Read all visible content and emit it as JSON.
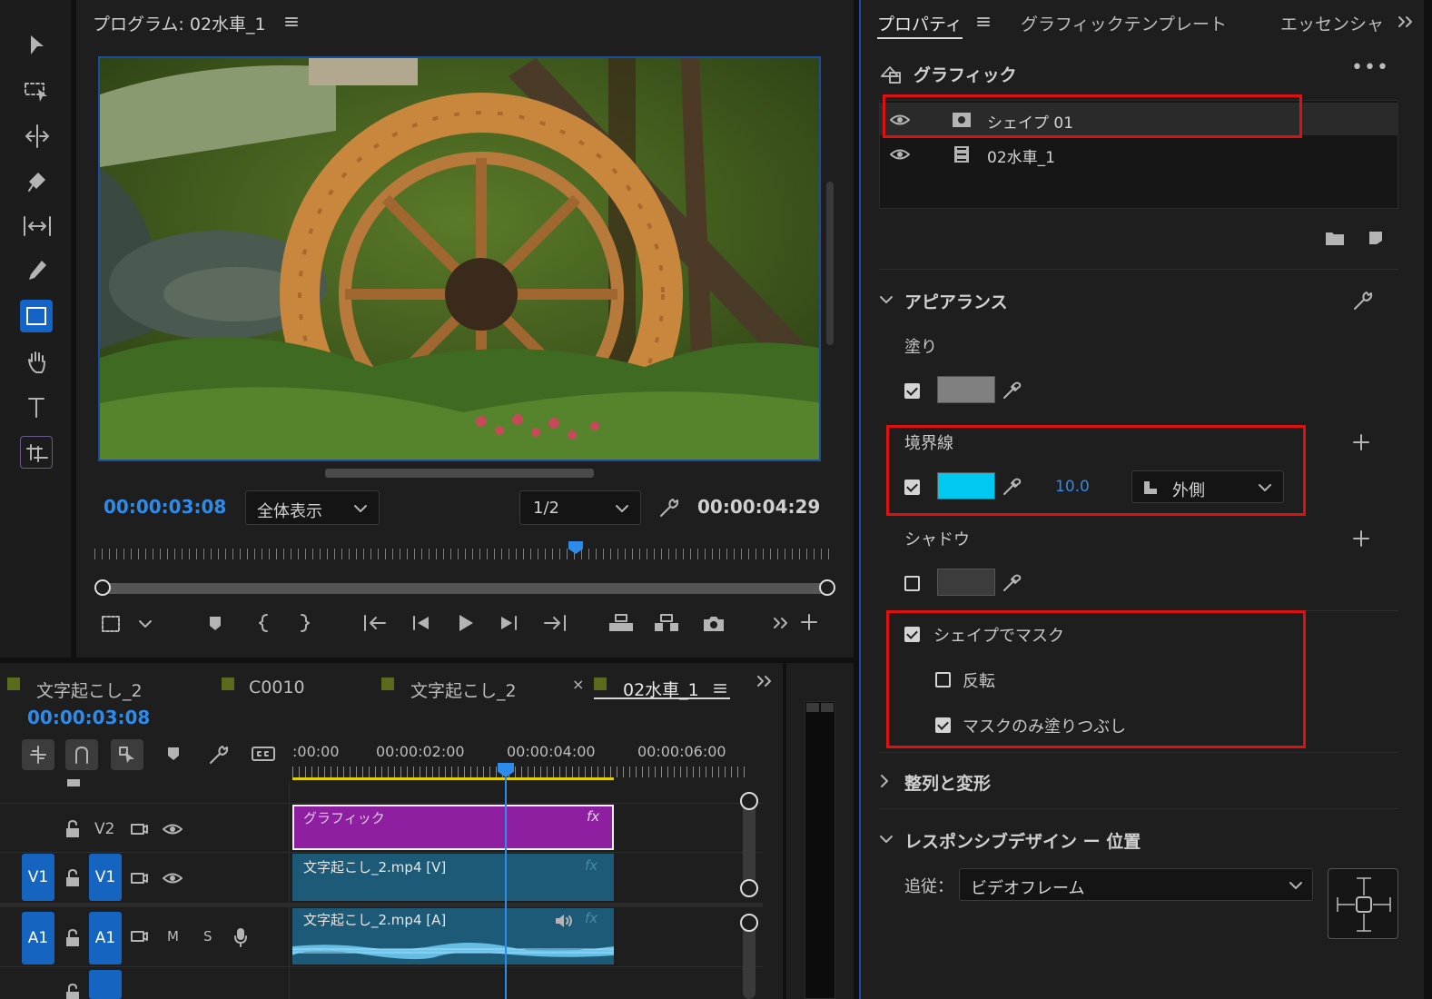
{
  "program_monitor": {
    "title": "プログラム: 02水車_1",
    "timecode_current": "00:00:03:08",
    "zoom_select": "全体表示",
    "resolution_select": "1/2",
    "timecode_duration": "00:00:04:29"
  },
  "properties_panel": {
    "tabs": [
      "プロパティ",
      "グラフィックテンプレート",
      "エッセンシャ"
    ],
    "graphic_header": "グラフィック",
    "layers": [
      {
        "name": "シェイプ 01",
        "type": "shape"
      },
      {
        "name": "02水車_1",
        "type": "video"
      }
    ],
    "appearance": {
      "section_title": "アピアランス",
      "fill_label": "塗り",
      "fill_checked": true,
      "fill_color": "#808080",
      "stroke_label": "境界線",
      "stroke_checked": true,
      "stroke_color": "#00c8f0",
      "stroke_width": "10.0",
      "stroke_position": "外側",
      "shadow_label": "シャドウ",
      "shadow_checked": false,
      "shadow_color": "#3c3c3c"
    },
    "mask": {
      "mask_with_shape_label": "シェイプでマスク",
      "mask_with_shape_checked": true,
      "invert_label": "反転",
      "invert_checked": false,
      "fill_mask_only_label": "マスクのみ塗りつぶし",
      "fill_mask_only_checked": true
    },
    "align_transform_title": "整列と変形",
    "responsive_title": "レスポンシブデザイン ー 位置",
    "follow_label": "追従：",
    "follow_value": "ビデオフレーム"
  },
  "timeline": {
    "tabs": [
      {
        "label": "文字起こし_2",
        "color": "#5a6b1c"
      },
      {
        "label": "C0010",
        "color": "#5a6b1c"
      },
      {
        "label": "文字起こし_2",
        "color": "#5a6b1c"
      },
      {
        "label": "02水車_1",
        "color": "#5a6b1c",
        "active": true
      }
    ],
    "close_mark": "×",
    "timecode": "00:00:03:08",
    "ruler_labels": [
      ":00:00",
      "00:00:02:00",
      "00:00:04:00",
      "00:00:06:00"
    ],
    "tracks": {
      "v2": {
        "label": "V2"
      },
      "v1": {
        "source": "V1",
        "label": "V1"
      },
      "a1": {
        "source": "A1",
        "label": "A1",
        "m": "M",
        "s": "S"
      }
    },
    "clips": {
      "graphic": {
        "label": "グラフィック",
        "fx": "fx",
        "color": "#8e1fa0"
      },
      "video": {
        "label": "文字起こし_2.mp4 [V]",
        "fx": "fx",
        "color": "#1c5a78"
      },
      "audio": {
        "label": "文字起こし_2.mp4 [A]",
        "fx": "fx",
        "color": "#1c5a78"
      }
    }
  }
}
